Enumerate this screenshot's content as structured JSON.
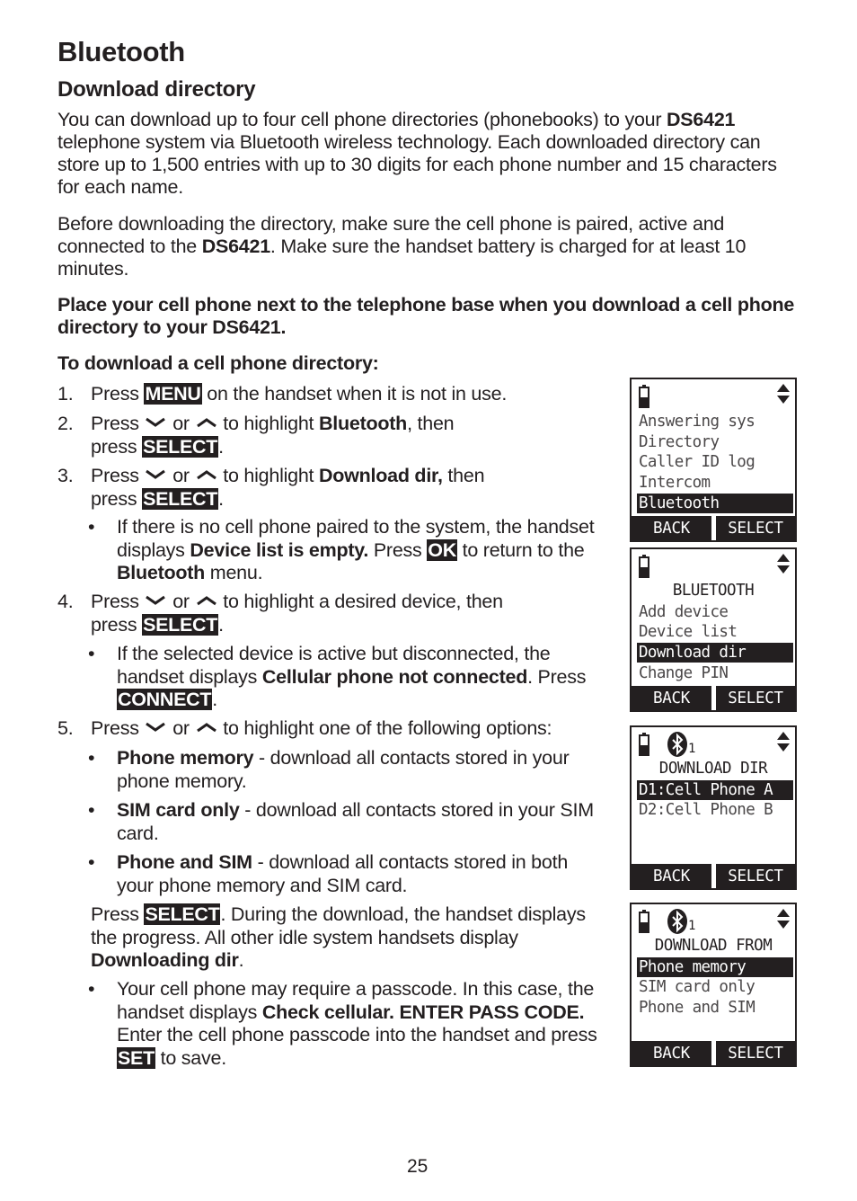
{
  "page": {
    "title": "Bluetooth",
    "section_title": "Download directory",
    "page_number": "25"
  },
  "intro": {
    "p1_a": "You can download up to four cell phone directories (phonebooks) to your ",
    "p1_model": "DS6421",
    "p1_b": " telephone system via Bluetooth wireless technology. Each downloaded directory can store up to 1,500 entries with up to 30 digits for each phone number and 15 characters for each name.",
    "p2_a": "Before downloading the directory, make sure the cell phone is paired, active and connected to the ",
    "p2_model": "DS6421",
    "p2_b": ". Make sure the handset battery is charged for at least 10 minutes.",
    "warning": "Place your cell phone next to the telephone base when you download a cell phone directory to your DS6421.",
    "procedure_title": "To download a cell phone directory:"
  },
  "words": {
    "press": "Press",
    "press_lc": "press",
    "or": "or",
    "period": ".",
    "comma_then": ", then"
  },
  "steps": [
    {
      "num": "1.",
      "key": "MENU",
      "text": " on the handset when it is not in use."
    },
    {
      "num": "2.",
      "text_a": " to highlight ",
      "bold": "Bluetooth",
      "text_b": ", then",
      "key": "SELECT"
    },
    {
      "num": "3.",
      "text_a": " to highlight ",
      "bold": "Download dir,",
      "text_b": " then",
      "key": "SELECT",
      "bullet": {
        "a": "If there is no cell phone paired to the system, the handset displays ",
        "bold1": "Device list is empty.",
        "b": " Press ",
        "key": "OK",
        "c": " to return to the ",
        "bold2": "Bluetooth",
        "d": " menu."
      }
    },
    {
      "num": "4.",
      "text_a": " to highlight a desired device, then",
      "key": "SELECT",
      "bullet": {
        "a": "If the selected device is active but disconnected, the handset displays ",
        "bold1": "Cellular phone not connected",
        "b": ". Press ",
        "key": "CONNECT",
        "c": "."
      }
    },
    {
      "num": "5.",
      "text_a": " to highlight one of the following options:",
      "options": [
        {
          "bold": "Phone memory",
          "text": " - download all contacts stored in your phone memory."
        },
        {
          "bold": "SIM card only",
          "text": " - download all contacts stored in your SIM card."
        },
        {
          "bold": "Phone and SIM",
          "text": " - download all contacts stored in both your phone memory and SIM card."
        }
      ],
      "after_a": "Press ",
      "after_key": "SELECT",
      "after_b": ". During the download, the handset displays the progress. All other idle system handsets display ",
      "after_bold": "Downloading dir",
      "after_c": ".",
      "bullet": {
        "a": "Your cell phone may require a passcode. In this case, the handset displays ",
        "bold1": "Check cellular. ENTER PASS CODE.",
        "b": " Enter the cell phone passcode into the handset and press ",
        "key": "SET",
        "c": " to save."
      }
    }
  ],
  "screens": [
    {
      "title": "",
      "bluetooth_indicator": false,
      "items": [
        "Answering sys",
        "Directory",
        "Caller ID log",
        "Intercom",
        "Bluetooth"
      ],
      "selected": "Bluetooth",
      "softkey_left": "BACK",
      "softkey_right": "SELECT"
    },
    {
      "title": "BLUETOOTH",
      "bluetooth_indicator": false,
      "items": [
        "Add device",
        "Device list",
        "Download dir",
        "Change PIN"
      ],
      "selected": "Download dir",
      "softkey_left": "BACK",
      "softkey_right": "SELECT"
    },
    {
      "title": "DOWNLOAD DIR",
      "bluetooth_indicator": true,
      "bluetooth_number": "1",
      "items": [
        "D1:Cell Phone A",
        "D2:Cell Phone B"
      ],
      "selected": "D1:Cell Phone A",
      "softkey_left": "BACK",
      "softkey_right": "SELECT"
    },
    {
      "title": "DOWNLOAD FROM",
      "bluetooth_indicator": true,
      "bluetooth_number": "1",
      "items": [
        "Phone memory",
        "SIM card only",
        "Phone and SIM"
      ],
      "selected": "Phone memory",
      "softkey_left": "BACK",
      "softkey_right": "SELECT"
    }
  ],
  "icons": {
    "down": "chevron-down-icon",
    "up": "chevron-up-icon",
    "battery": "battery-icon",
    "scroll": "scroll-arrows-icon",
    "bluetooth": "bluetooth-icon"
  },
  "colors": {
    "text": "#231f20",
    "key_bg": "#231f20",
    "key_fg": "#ffffff"
  }
}
